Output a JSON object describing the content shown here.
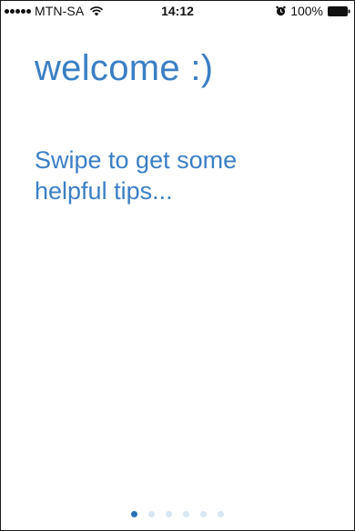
{
  "status_bar": {
    "carrier": "MTN-SA",
    "time": "14:12",
    "battery_percent": "100%",
    "signal_strength_dots": 5,
    "icons": [
      "signal-dots-icon",
      "wifi-icon",
      "alarm-icon",
      "battery-icon"
    ]
  },
  "content": {
    "title": "welcome :)",
    "tips_line1": "Swipe to get some",
    "tips_line2": "helpful tips..."
  },
  "pager": {
    "total_pages": 6,
    "current_page": 1
  },
  "colors": {
    "accent": "#3b7fc4",
    "dot_active": "#2b6fb6",
    "dot_inactive": "#d8e6f3"
  }
}
